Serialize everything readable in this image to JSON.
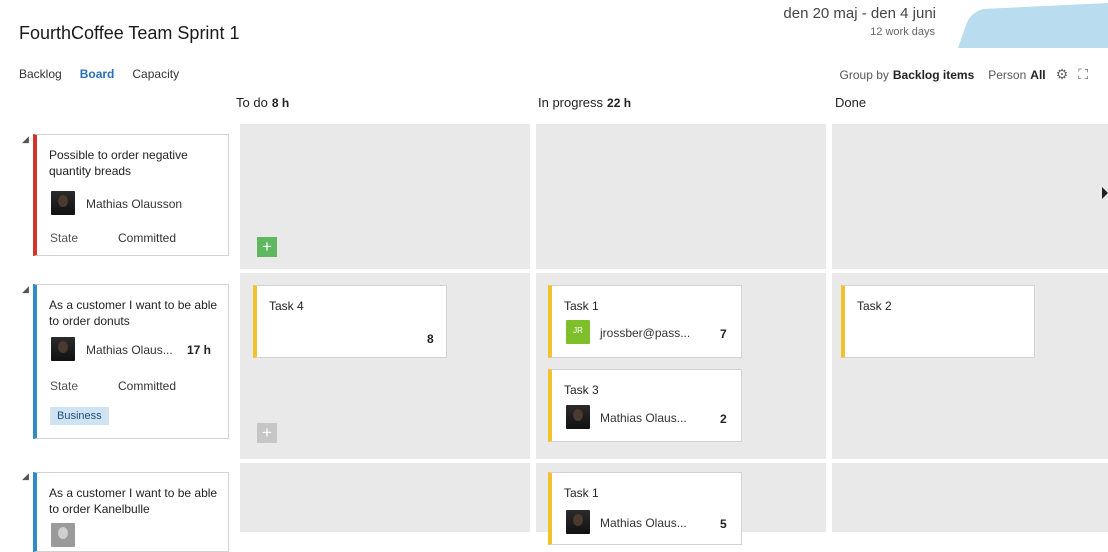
{
  "header": {
    "title": "FourthCoffee Team Sprint 1",
    "dates": "den 20 maj - den 4 juni",
    "work_days": "12 work days"
  },
  "nav": {
    "backlog": "Backlog",
    "board": "Board",
    "capacity": "Capacity",
    "active": "Board"
  },
  "tools": {
    "group_by_label": "Group by",
    "group_by_value": "Backlog items",
    "person_label": "Person",
    "person_value": "All",
    "settings_icon": "gear-icon",
    "fullscreen_icon": "fullscreen-icon"
  },
  "columns": {
    "todo": {
      "name": "To do",
      "hours": "8 h"
    },
    "inprogress": {
      "name": "In progress",
      "hours": "22 h"
    },
    "done": {
      "name": "Done"
    }
  },
  "rows": [
    {
      "item": {
        "title": "Possible to order negative quantity breads",
        "assignee": "Mathias Olausson",
        "state_label": "State",
        "state": "Committed",
        "color": "#d0342c"
      }
    },
    {
      "item": {
        "title": "As a customer I want to be able to order donuts",
        "assignee": "Mathias Olaus...",
        "hours": "17 h",
        "state_label": "State",
        "state": "Committed",
        "tag": "Business",
        "color": "#2f8cc6"
      },
      "tasks": {
        "todo": [
          {
            "title": "Task 4",
            "remaining": "8"
          }
        ],
        "inprogress": [
          {
            "title": "Task 1",
            "assignee": "jrossber@pass...",
            "avatar_initials": "JR",
            "remaining": "7"
          },
          {
            "title": "Task 3",
            "assignee": "Mathias Olaus...",
            "remaining": "2"
          }
        ],
        "done": [
          {
            "title": "Task 2"
          }
        ]
      }
    },
    {
      "item": {
        "title": "As a customer I want to be able to order Kanelbulle",
        "color": "#2f8cc6"
      },
      "tasks": {
        "inprogress": [
          {
            "title": "Task 1",
            "assignee": "Mathias Olaus...",
            "remaining": "5"
          }
        ]
      }
    }
  ],
  "colors": {
    "accent": "#2a6ebb",
    "task_bar": "#f2c12e",
    "add_green": "#5fb75f",
    "lane_bg": "#e9e9e9",
    "burndown": "#b9dcef"
  }
}
